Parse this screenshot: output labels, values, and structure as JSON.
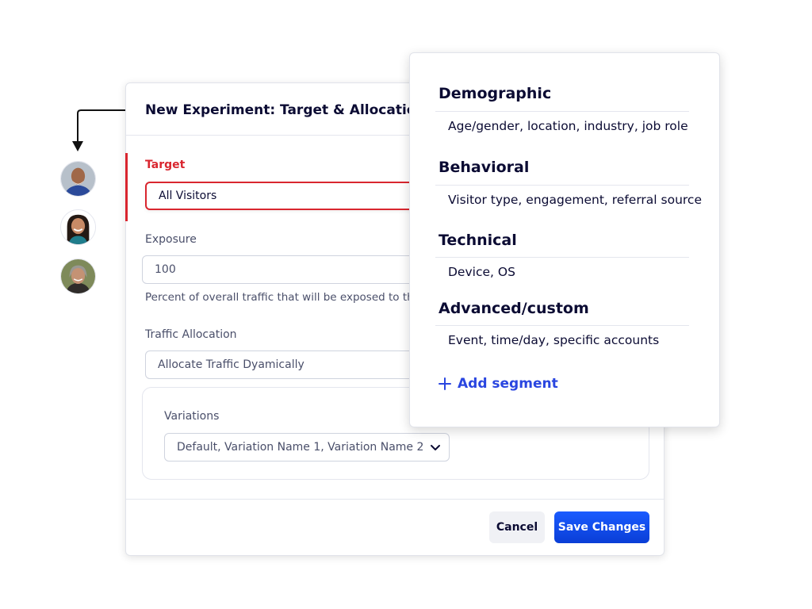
{
  "dialog": {
    "title": "New Experiment: Target & Allocation",
    "target_label": "Target",
    "target_value": "All Visitors",
    "exposure_label": "Exposure",
    "exposure_value": "100",
    "exposure_help": "Percent of overall traffic that will be exposed to this",
    "traffic_label": "Traffic Allocation",
    "traffic_value": "Allocate Traffic Dyamically",
    "variations_label": "Variations",
    "variations_value": "Default, Variation Name 1, Variation Name 2",
    "cancel_label": "Cancel",
    "save_label": "Save Changes"
  },
  "segments": {
    "groups": [
      {
        "heading": "Demographic",
        "description": "Age/gender, location, industry, job role"
      },
      {
        "heading": "Behavioral",
        "description": "Visitor type, engagement, referral source"
      },
      {
        "heading": "Technical",
        "description": "Device, OS"
      },
      {
        "heading": "Advanced/custom",
        "description": "Event, time/day, specific accounts"
      }
    ],
    "add_label": "Add segment"
  },
  "colors": {
    "accent_red": "#d9262f",
    "primary_blue": "#0d46e8",
    "link_blue": "#2a46e0",
    "text_dark": "#0b0b33"
  },
  "icons": [
    "arrow-connector-icon",
    "chevron-down-icon",
    "plus-icon"
  ]
}
